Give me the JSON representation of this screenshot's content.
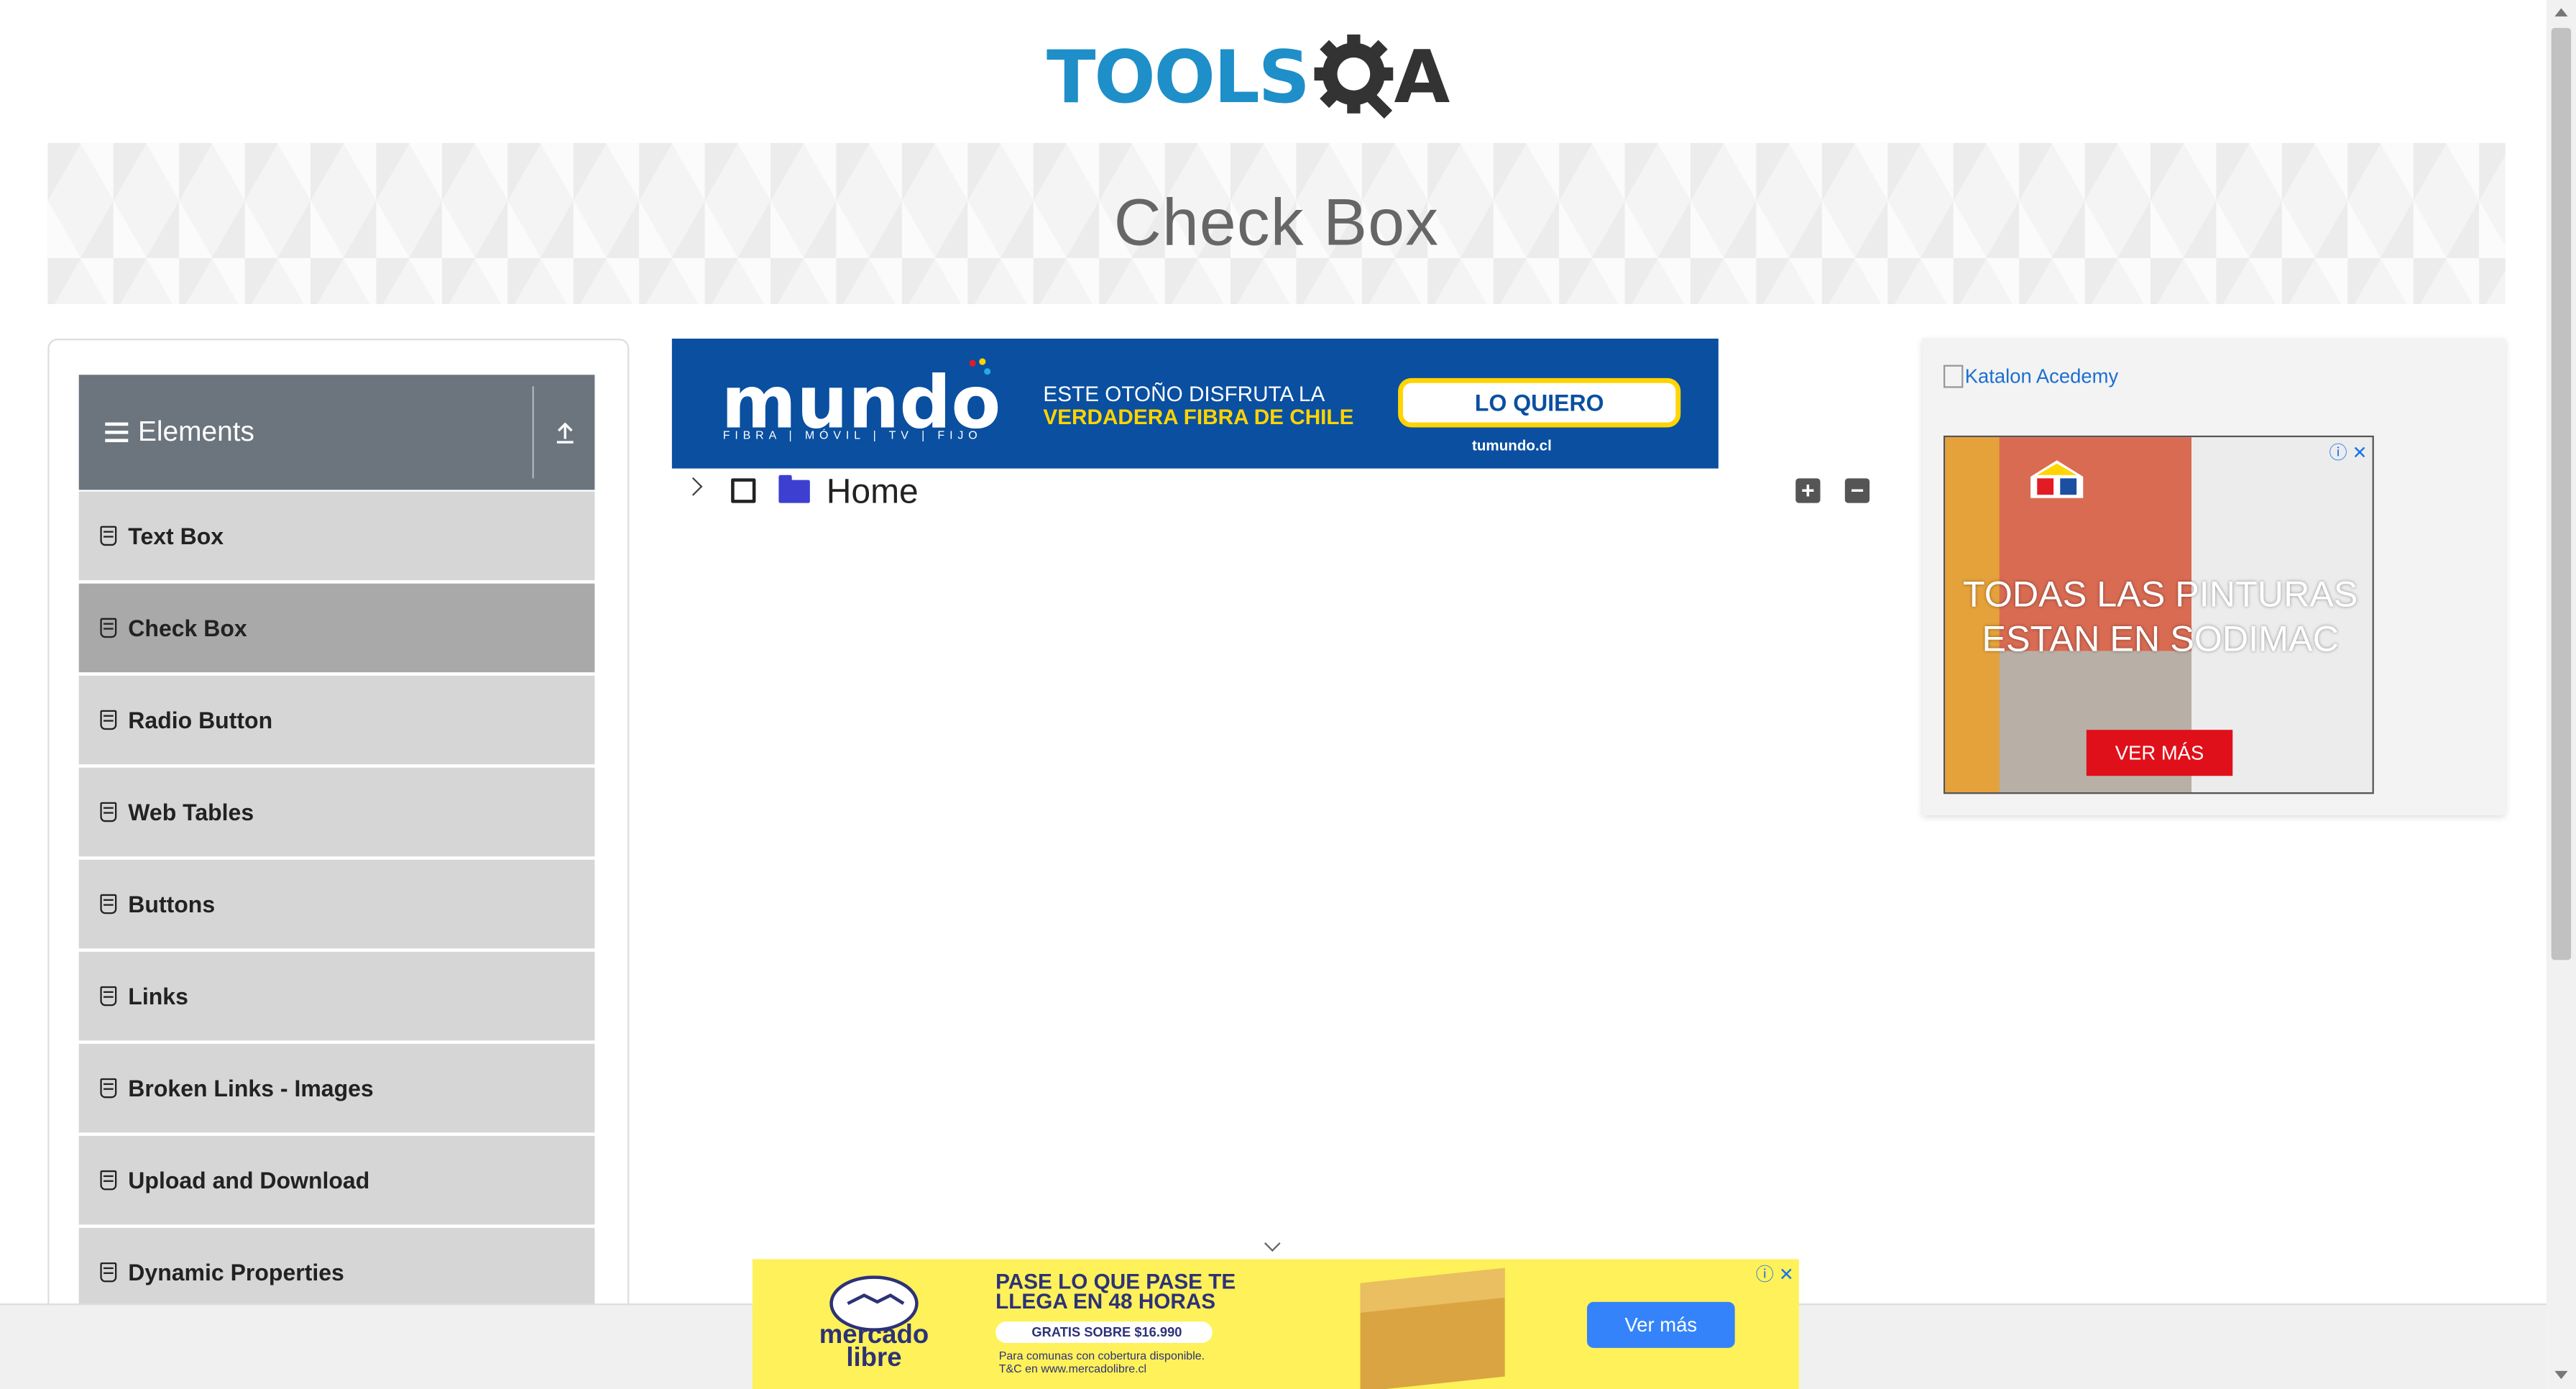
{
  "logo": {
    "text": "TOOLS",
    "suffix": "A"
  },
  "page_title": "Check Box",
  "sidebar": {
    "group_title": "Elements",
    "items": [
      {
        "label": "Text Box",
        "active": false
      },
      {
        "label": "Check Box",
        "active": true
      },
      {
        "label": "Radio Button",
        "active": false
      },
      {
        "label": "Web Tables",
        "active": false
      },
      {
        "label": "Buttons",
        "active": false
      },
      {
        "label": "Links",
        "active": false
      },
      {
        "label": "Broken Links - Images",
        "active": false
      },
      {
        "label": "Upload and Download",
        "active": false
      },
      {
        "label": "Dynamic Properties",
        "active": false
      }
    ]
  },
  "ad_top": {
    "brand": "mundo",
    "brand_sub": "FIBRA | MÓVIL | TV | FIJO",
    "line1": "ESTE OTOÑO DISFRUTA LA",
    "line2": "VERDADERA FIBRA DE CHILE",
    "cta": "LO QUIERO",
    "url": "tumundo.cl"
  },
  "tree": {
    "root_label": "Home",
    "expand_all_icon": "+",
    "collapse_all_icon": "−"
  },
  "right_ad": {
    "broken_image_alt": "Katalon Acedemy",
    "headline": "TODAS LAS PINTURAS ESTAN EN SODIMAC",
    "cta": "VER MÁS"
  },
  "ad_bottom": {
    "brand": "mercado libre",
    "head": "PASE LO QUE PASE TE LLEGA EN 48 HORAS",
    "pill": "GRATIS SOBRE $16.990",
    "small1": "Para comunas con cobertura disponible.",
    "small2": "T&C en www.mercadolibre.cl",
    "cta": "Ver más"
  },
  "colors": {
    "brand_blue": "#1e8fc8",
    "group_header": "#6c757d",
    "menu_item": "#d6d6d6",
    "menu_active": "#a9a9a9"
  }
}
